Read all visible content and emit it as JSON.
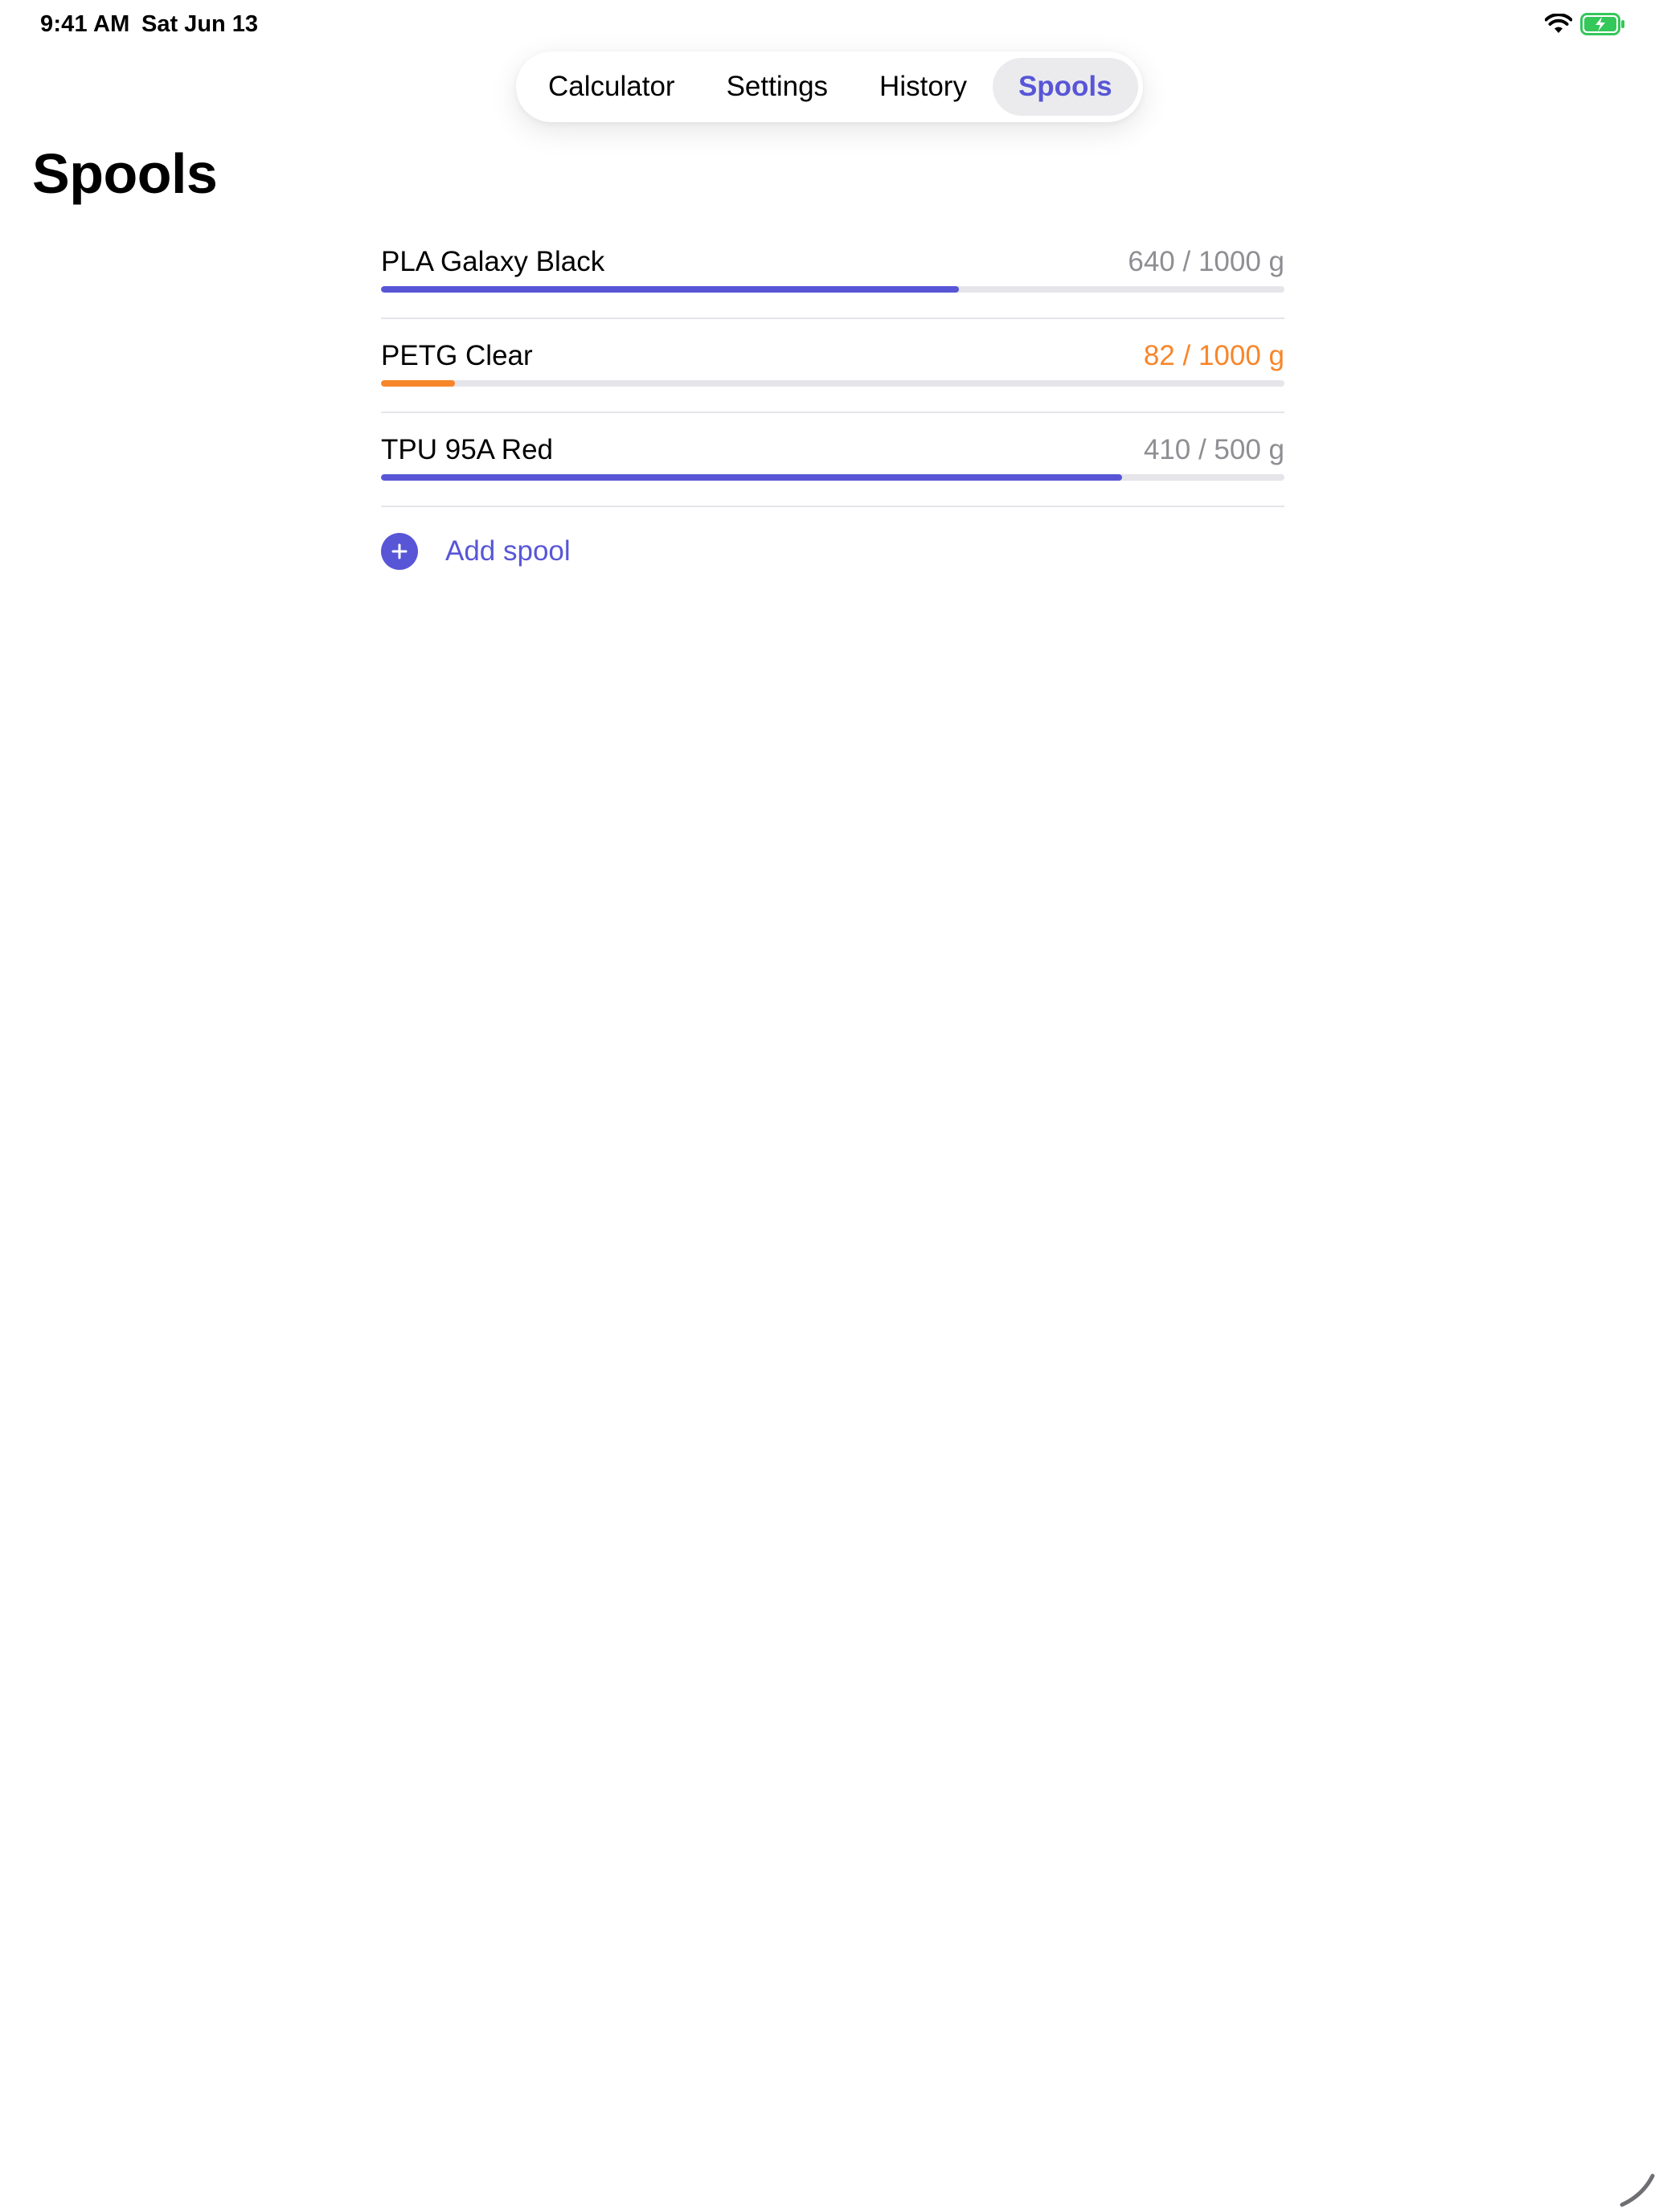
{
  "status_bar": {
    "time": "9:41 AM",
    "date": "Sat Jun 13",
    "wifi_icon": "wifi-icon",
    "battery_icon": "battery-charging-icon"
  },
  "tabs": [
    {
      "label": "Calculator",
      "active": false
    },
    {
      "label": "Settings",
      "active": false
    },
    {
      "label": "History",
      "active": false
    },
    {
      "label": "Spools",
      "active": true
    }
  ],
  "page": {
    "title": "Spools"
  },
  "spools": [
    {
      "name": "PLA Galaxy Black",
      "amount": "640 / 1000 g",
      "remaining_g": 640,
      "capacity_g": 1000,
      "status": "normal"
    },
    {
      "name": "PETG Clear",
      "amount": "82 / 1000 g",
      "remaining_g": 82,
      "capacity_g": 1000,
      "status": "low"
    },
    {
      "name": "TPU 95A Red",
      "amount": "410 / 500 g",
      "remaining_g": 410,
      "capacity_g": 500,
      "status": "normal"
    }
  ],
  "add_spool": {
    "label": "Add spool",
    "icon": "plus-circle-icon"
  },
  "colors": {
    "accent": "#5856d6",
    "warning": "#f7862a",
    "track": "#e5e5ea",
    "secondary_text": "#8e8e93"
  }
}
